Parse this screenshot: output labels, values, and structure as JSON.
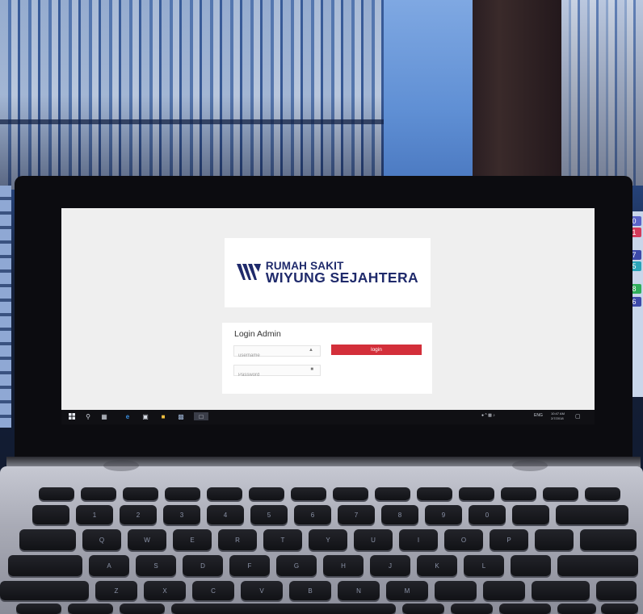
{
  "photo": {
    "scene": "",
    "shelf_tabs": [
      "0",
      "1",
      "7",
      "5",
      "8",
      "6"
    ]
  },
  "app": {
    "logo": {
      "line1": "RUMAH SAKIT",
      "line2": "WIYUNG SEJAHTERA",
      "color": "#1f2a6b"
    },
    "login": {
      "title": "Login Admin",
      "username_placeholder": "username",
      "password_placeholder": "Password",
      "button_label": "login",
      "button_color": "#d32f3a"
    }
  },
  "taskbar": {
    "language": "ENG",
    "time": "10:47 AM",
    "date": "2/7/2018"
  },
  "keyboard": {
    "row_qwerty": [
      "Q",
      "W",
      "E",
      "R",
      "T",
      "Y",
      "U",
      "I",
      "O",
      "P"
    ],
    "row_asdf": [
      "A",
      "S",
      "D",
      "F",
      "G",
      "H",
      "J",
      "K",
      "L"
    ],
    "row_zxcv": [
      "Z",
      "X",
      "C",
      "V",
      "B",
      "N",
      "M"
    ],
    "numbers": [
      "1",
      "2",
      "3",
      "4",
      "5",
      "6",
      "7",
      "8",
      "9",
      "0"
    ]
  }
}
